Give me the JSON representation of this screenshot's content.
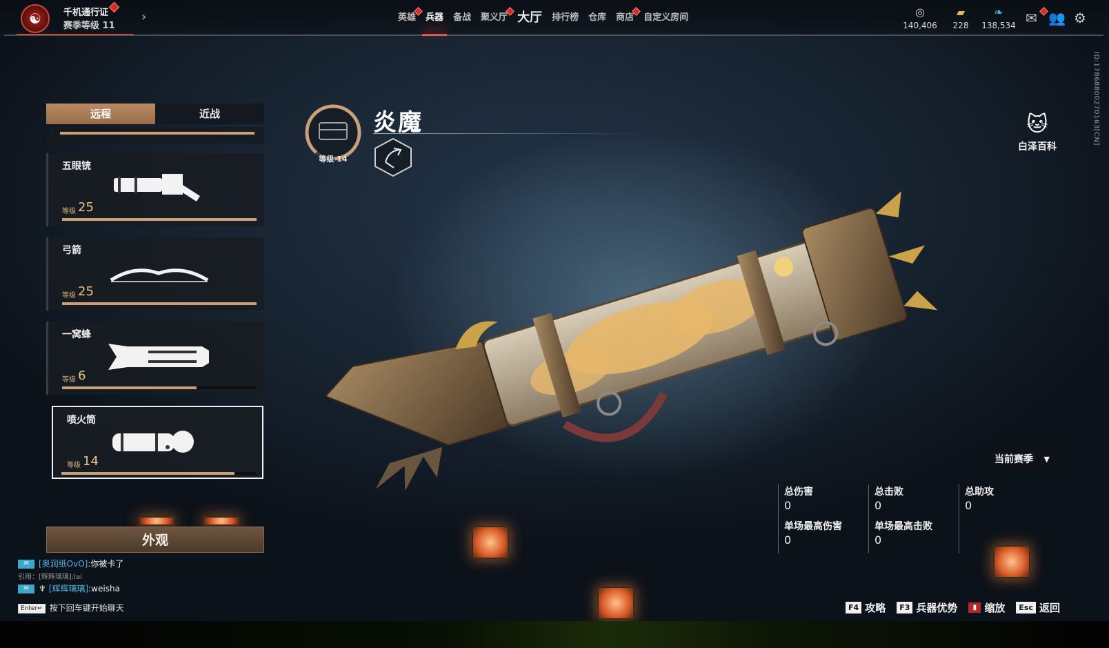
{
  "topbar": {
    "pass_title": "千机通行证",
    "season_level": "赛季等级 11",
    "nav": [
      {
        "label": "英雄",
        "active": false,
        "badge": true
      },
      {
        "label": "兵器",
        "active": true,
        "badge": false
      },
      {
        "label": "备战",
        "active": false,
        "badge": false
      },
      {
        "label": "聚义厅",
        "active": false,
        "badge": true
      },
      {
        "label": "大厅",
        "active": false,
        "badge": false,
        "big": true
      },
      {
        "label": "排行榜",
        "active": false,
        "badge": false
      },
      {
        "label": "仓库",
        "active": false,
        "badge": false
      },
      {
        "label": "商店",
        "active": false,
        "badge": true
      },
      {
        "label": "自定义房间",
        "active": false,
        "badge": false
      }
    ],
    "currencies": [
      {
        "icon": "coin-stack-icon",
        "value": "140,406"
      },
      {
        "icon": "ticket-icon",
        "value": "228"
      },
      {
        "icon": "feather-icon",
        "value": "138,534"
      }
    ]
  },
  "left_panel": {
    "tabs": [
      "远程",
      "近战"
    ],
    "active_tab": "远程",
    "weapons": [
      {
        "name": "五眼铳",
        "level_label": "等级",
        "level": "25",
        "xp": 1.0,
        "icon": "five-eye-gun-icon"
      },
      {
        "name": "弓箭",
        "level_label": "等级",
        "level": "25",
        "xp": 1.0,
        "icon": "bow-icon"
      },
      {
        "name": "一窝蜂",
        "level_label": "等级",
        "level": "6",
        "xp": 0.69,
        "icon": "rocket-launcher-icon"
      },
      {
        "name": "喷火筒",
        "level_label": "等级",
        "level": "14",
        "xp": 0.89,
        "icon": "flamethrower-icon",
        "selected": true
      }
    ],
    "appearance_button": "外观"
  },
  "weapon": {
    "title": "炎魔",
    "level_text": "等级 14",
    "type_icon": "ranged-weapon-icon"
  },
  "right_panel": {
    "encyclopedia": "白泽百科",
    "player_id": "ID:178688002701​63[CN]",
    "season_select": "当前赛季",
    "stats": [
      {
        "label": "总伤害",
        "value": "0"
      },
      {
        "label": "总击败",
        "value": "0"
      },
      {
        "label": "总助攻",
        "value": "0"
      },
      {
        "label": "单场最高伤害",
        "value": "0"
      },
      {
        "label": "单场最高击败",
        "value": "0"
      }
    ]
  },
  "chat": {
    "messages": [
      {
        "name": "[奥润纸OvO]",
        "text": ":你被卡了"
      },
      {
        "quote": "引用：[辉辉璃璃]:lai"
      },
      {
        "name": "[辉辉璃璃]",
        "text": ":weisha"
      }
    ],
    "hint_key": "Enter↵",
    "hint": "按下回车键开始聊天"
  },
  "hotkeys": [
    {
      "key": "F4",
      "label": "攻略"
    },
    {
      "key": "F3",
      "label": "兵器优势"
    },
    {
      "key": "",
      "label": "缩放",
      "book": true
    },
    {
      "key": "Esc",
      "label": "返回"
    }
  ],
  "colors": {
    "accent_red": "#e03a2c",
    "tab_active": "#b98a63",
    "xp_bar": "#c8a07a",
    "level_gold": "#e7c48a",
    "chat_name": "#4fb7e3"
  }
}
